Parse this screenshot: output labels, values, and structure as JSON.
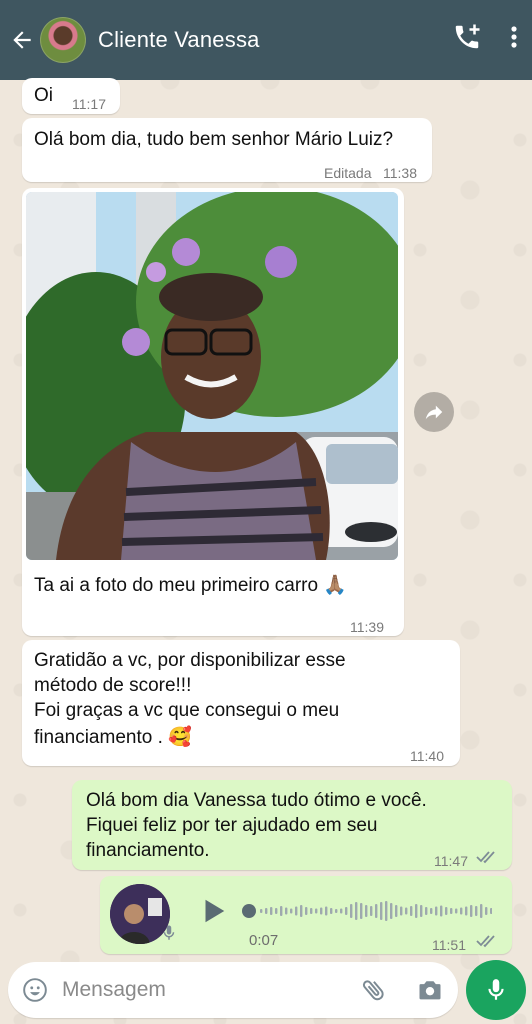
{
  "header": {
    "contact_name": "Cliente Vanessa",
    "back_icon": "arrow-left-icon",
    "call_icon": "add-call-icon",
    "menu_icon": "more-vertical-icon"
  },
  "messages": [
    {
      "direction": "in",
      "text": "Oi",
      "time": "11:17"
    },
    {
      "direction": "in",
      "text": "Olá bom dia, tudo bem senhor Mário Luiz?",
      "edited": "Editada",
      "time": "11:38"
    },
    {
      "direction": "in",
      "type": "image",
      "caption": "Ta ai a foto do meu primeiro carro 🙏🏽",
      "time": "11:39"
    },
    {
      "direction": "in",
      "lines": [
        "Gratidão a vc, por disponibilizar esse",
        "método de score!!!",
        "Foi graças a vc que consegui o meu",
        "financiamento . 🥰"
      ],
      "time": "11:40"
    },
    {
      "direction": "out",
      "lines": [
        "Olá bom dia Vanessa tudo ótimo e você.",
        "Fiquei feliz por ter ajudado em seu",
        "financiamento."
      ],
      "time": "11:47",
      "status": "read"
    },
    {
      "direction": "out",
      "type": "audio",
      "duration": "0:07",
      "time": "11:51",
      "status": "read"
    }
  ],
  "input": {
    "placeholder": "Mensagem",
    "emoji_icon": "emoji-icon",
    "attach_icon": "paperclip-icon",
    "camera_icon": "camera-icon",
    "mic_icon": "microphone-icon"
  },
  "colors": {
    "header": "#3f5660",
    "incoming": "#ffffff",
    "outgoing": "#dcf8c6",
    "accent": "#1aa45f",
    "read_ticks": "#7e8c96"
  }
}
